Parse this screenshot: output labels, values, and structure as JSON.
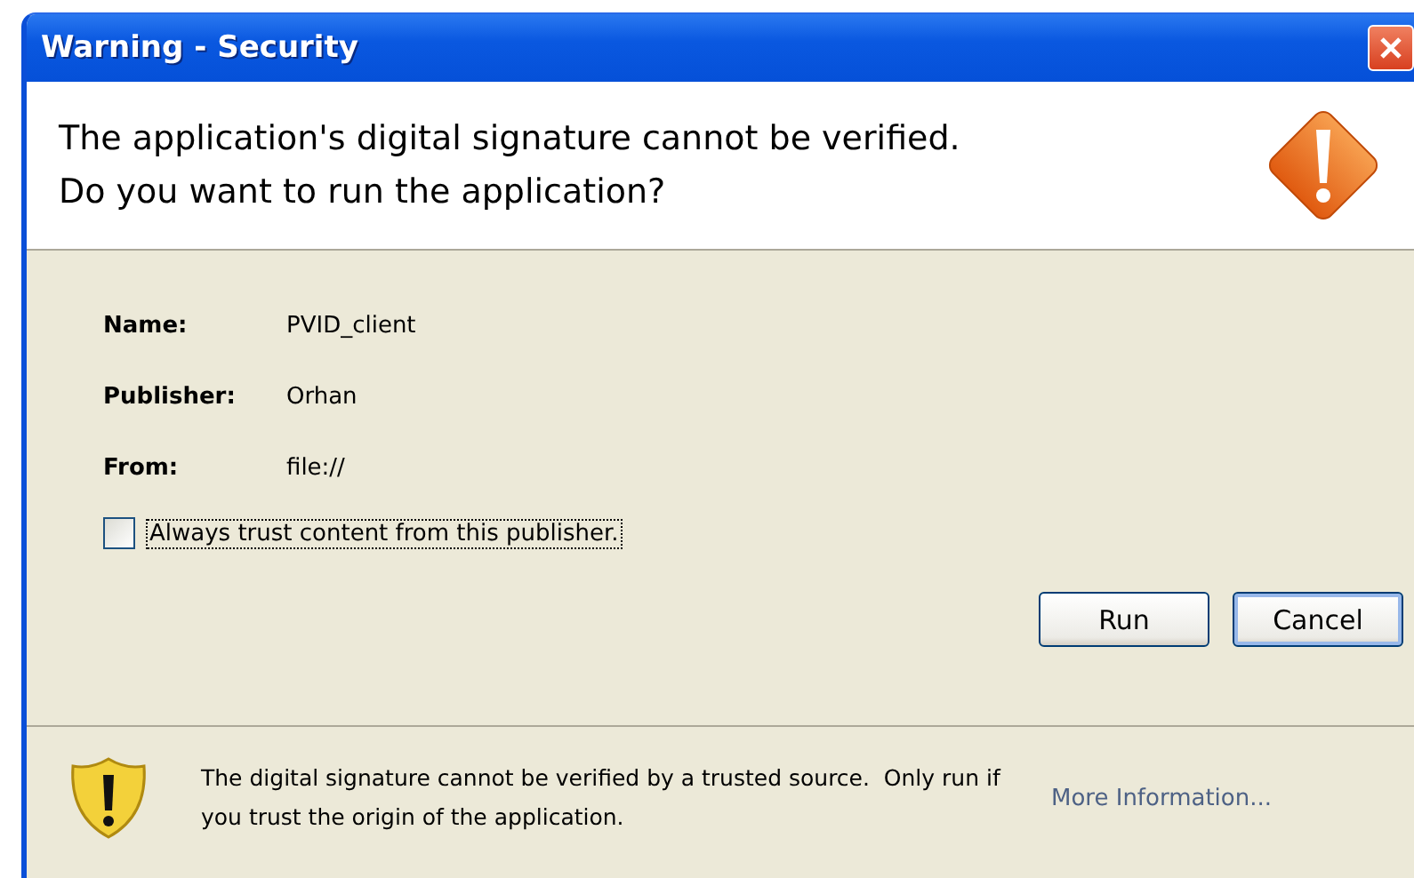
{
  "window": {
    "title": "Warning - Security"
  },
  "header": {
    "message": "The application's digital signature cannot be verified.\nDo you want to run the application?"
  },
  "details": [
    {
      "label": "Name:",
      "value": "PVID_client"
    },
    {
      "label": "Publisher:",
      "value": "Orhan"
    },
    {
      "label": "From:",
      "value": "file://"
    }
  ],
  "trust_checkbox": {
    "label": "Always trust content from this publisher.",
    "checked": false
  },
  "buttons": [
    {
      "label": "Run",
      "default": false
    },
    {
      "label": "Cancel",
      "default": true
    }
  ],
  "footer": {
    "message": "The digital signature cannot be verified by a trusted source.  Only run if you trust the origin of the application.",
    "link": "More Information..."
  }
}
